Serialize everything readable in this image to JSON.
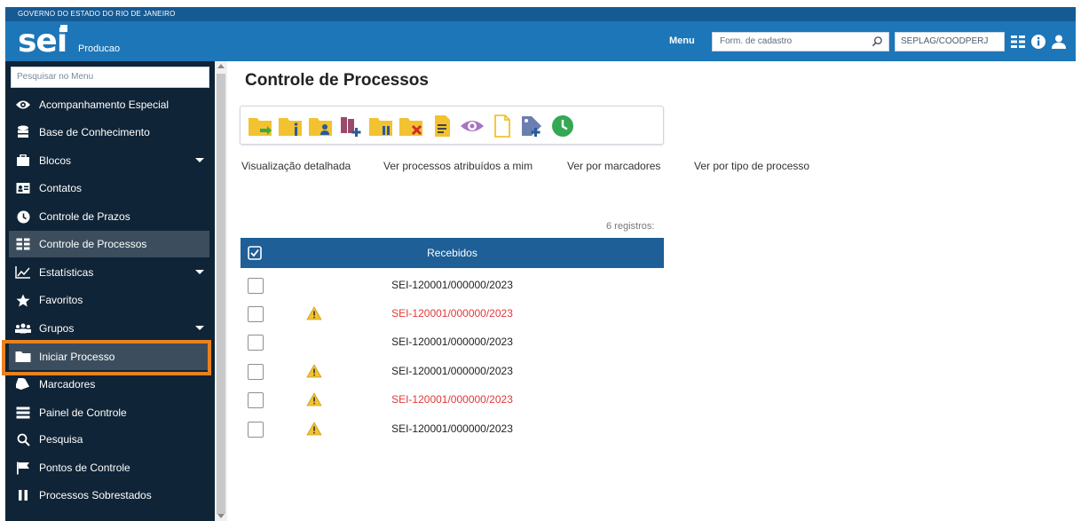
{
  "gov_bar": {
    "text": "GOVERNO DO ESTADO DO RIO DE JANEIRO"
  },
  "header": {
    "logo": "sei",
    "environment": "Producao",
    "menu_label": "Menu",
    "search_placeholder": "Form. de cadastro",
    "unit": "SEPLAG/COODPERJ",
    "icons": [
      "search-icon",
      "grid-icon",
      "info-icon",
      "user-icon"
    ]
  },
  "sidebar": {
    "search_placeholder": "Pesquisar no Menu",
    "items": [
      {
        "label": "Acompanhamento Especial",
        "icon": "eye-icon",
        "expandable": false
      },
      {
        "label": "Base de Conhecimento",
        "icon": "database-icon",
        "expandable": false
      },
      {
        "label": "Blocos",
        "icon": "briefcase-icon",
        "expandable": true
      },
      {
        "label": "Contatos",
        "icon": "contact-card-icon",
        "expandable": false
      },
      {
        "label": "Controle de Prazos",
        "icon": "clock-icon",
        "expandable": false
      },
      {
        "label": "Controle de Processos",
        "icon": "list-grid-icon",
        "expandable": false,
        "active": true
      },
      {
        "label": "Estatísticas",
        "icon": "chart-icon",
        "expandable": true
      },
      {
        "label": "Favoritos",
        "icon": "star-icon",
        "expandable": false
      },
      {
        "label": "Grupos",
        "icon": "group-icon",
        "expandable": true
      },
      {
        "label": "Iniciar Processo",
        "icon": "folder-icon",
        "expandable": false,
        "highlighted": true
      },
      {
        "label": "Marcadores",
        "icon": "tag-icon",
        "expandable": false
      },
      {
        "label": "Painel de Controle",
        "icon": "panel-icon",
        "expandable": false
      },
      {
        "label": "Pesquisa",
        "icon": "search-icon",
        "expandable": false
      },
      {
        "label": "Pontos de Controle",
        "icon": "flag-icon",
        "expandable": false
      },
      {
        "label": "Processos Sobrestados",
        "icon": "pause-icon",
        "expandable": false
      }
    ],
    "highlight_color": "#e8821e"
  },
  "main": {
    "title": "Controle de Processos",
    "toolbar_icons": [
      "folder-send-icon",
      "folder-info-icon",
      "folder-user-icon",
      "books-add-icon",
      "folder-pause-icon",
      "folder-cancel-icon",
      "document-sign-icon",
      "eye-icon",
      "new-document-icon",
      "tag-add-icon",
      "clock-icon"
    ],
    "view_links": [
      "Visualização detalhada",
      "Ver processos atribuídos a mim",
      "Ver por marcadores",
      "Ver por tipo de processo"
    ],
    "records": "6 registros:",
    "table": {
      "header": "Recebidos",
      "rows": [
        {
          "process": "SEI-120001/000000/2023",
          "warning": false,
          "unread": false
        },
        {
          "process": "SEI-120001/000000/2023",
          "warning": true,
          "unread": true
        },
        {
          "process": "SEI-120001/000000/2023",
          "warning": false,
          "unread": false
        },
        {
          "process": "SEI-120001/000000/2023",
          "warning": true,
          "unread": false
        },
        {
          "process": "SEI-120001/000000/2023",
          "warning": true,
          "unread": true
        },
        {
          "process": "SEI-120001/000000/2023",
          "warning": true,
          "unread": false
        }
      ]
    }
  },
  "colors": {
    "header_blue": "#1d76b8",
    "gov_bar_blue": "#155a93",
    "sidebar_bg": "#0f2436",
    "table_head": "#1d5f96",
    "unread_red": "#e03a3a"
  }
}
